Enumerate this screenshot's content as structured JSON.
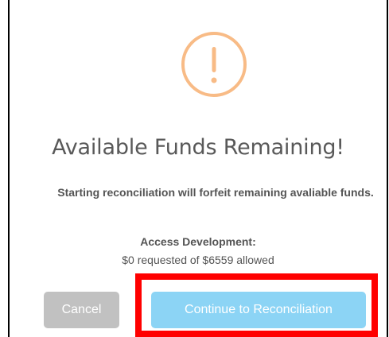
{
  "dialog": {
    "icon": "warning-exclamation-icon",
    "icon_color": "#f8bb86",
    "title": "Available Funds Remaining!",
    "message": "Starting reconciliation will forfeit remaining avaliable funds.",
    "funds": {
      "label": "Access Development:",
      "amount_text": "$0 requested of $6559 allowed"
    },
    "buttons": {
      "cancel_label": "Cancel",
      "cancel_color": "#c1c1c1",
      "continue_label": "Continue to Reconciliation",
      "continue_color": "#8cd4f5"
    },
    "highlight_color": "#ff0000"
  }
}
